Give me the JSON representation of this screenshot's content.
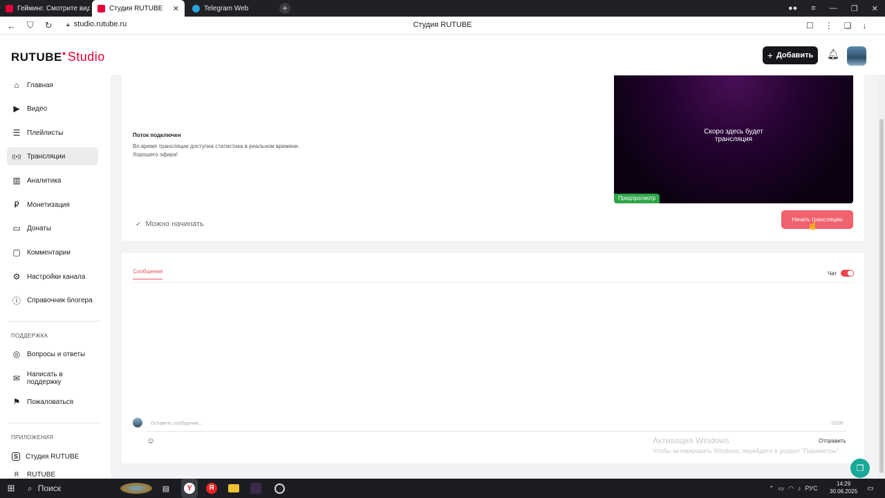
{
  "browser": {
    "tabs": [
      {
        "label": "Гейминг. Смотрите видео",
        "fav_color": "#e4003a"
      },
      {
        "label": "Студия RUTUBE",
        "fav_color": "#e4003a"
      },
      {
        "label": "Telegram Web",
        "fav_color": "#2aa3e0"
      }
    ],
    "tab_close": "✕",
    "new_tab": "+",
    "url": "studio.rutube.ru",
    "page_title": "Студия RUTUBE"
  },
  "header": {
    "logo_main": "RUTUBE",
    "logo_sub": "Studio",
    "add_label": "Добавить"
  },
  "sidebar": {
    "items": [
      {
        "label": "Главная",
        "icon": "⌂"
      },
      {
        "label": "Видео",
        "icon": "▶"
      },
      {
        "label": "Плейлисты",
        "icon": "☰"
      },
      {
        "label": "Трансляции",
        "icon": "((•))"
      },
      {
        "label": "Аналитика",
        "icon": "▥"
      },
      {
        "label": "Монетизация",
        "icon": "₽"
      },
      {
        "label": "Донаты",
        "icon": "▭"
      },
      {
        "label": "Комментарии",
        "icon": "▢"
      },
      {
        "label": "Настройки канала",
        "icon": "⚙"
      },
      {
        "label": "Справочник блогера",
        "icon": "ⓘ"
      }
    ],
    "support_title": "ПОДДЕРЖКА",
    "support_items": [
      {
        "label": "Вопросы и ответы",
        "icon": "◎"
      },
      {
        "label": "Написать в поддержку",
        "icon": "✉"
      },
      {
        "label": "Пожаловаться",
        "icon": "⚑"
      }
    ],
    "apps_title": "ПРИЛОЖЕНИЯ",
    "apps_items": [
      {
        "label": "Студия RUTUBE",
        "icon": "S"
      },
      {
        "label": "RUTUBE",
        "icon": "R"
      }
    ]
  },
  "stream": {
    "status_title": "Поток подключен",
    "status_line1": "Во время трансляции доступна статистика в реальном времени.",
    "status_line2": "Хорошего эфира!",
    "preview_line1": "Скоро здесь будет",
    "preview_line2": "трансляция",
    "preview_tag": "Предпросмотр",
    "ready_text": "Можно начинать",
    "start_button": "Начать трансляцию"
  },
  "chat": {
    "tab_messages": "Сообщения",
    "chat_label": "Чат",
    "chat_enabled": true,
    "input_placeholder": "Оставить сообщение...",
    "counter": "0/200",
    "send_label": "Отправить"
  },
  "watermark": {
    "title": "Активация Windows",
    "text": "Чтобы активировать Windows, перейдите в раздел \"Параметры\"."
  },
  "taskbar": {
    "search_label": "Поиск",
    "lang": "РУС",
    "time": "14:29",
    "date": "30.06.2025"
  },
  "colors": {
    "accent": "#e4003a",
    "start_button": "#f0626e",
    "preview_tag": "#2ea649",
    "toggle_on": "#e9434f",
    "support_fab": "#18a999"
  }
}
